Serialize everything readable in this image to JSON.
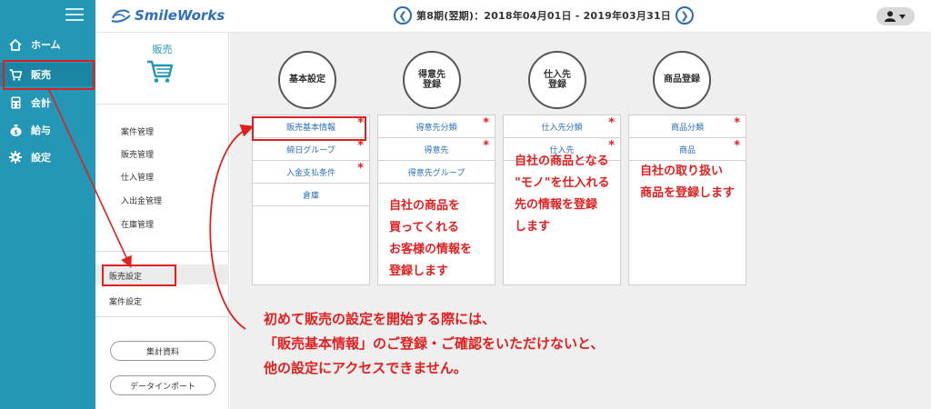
{
  "app": {
    "logo_text": "SmileWorks"
  },
  "header": {
    "period": "第8期(翌期)：2018年04月01日 - 2019年03月31日"
  },
  "nav": {
    "items": [
      {
        "label": "ホーム",
        "icon": "home-icon"
      },
      {
        "label": "販売",
        "icon": "cart-icon",
        "active": true
      },
      {
        "label": "会計",
        "icon": "calculator-icon"
      },
      {
        "label": "給与",
        "icon": "money-bag-icon"
      },
      {
        "label": "設定",
        "icon": "gear-icon"
      }
    ]
  },
  "subnav": {
    "title": "販売",
    "links": [
      "案件管理",
      "販売管理",
      "仕入管理",
      "入出金管理",
      "在庫管理"
    ],
    "settings": [
      "販売設定",
      "案件設定"
    ],
    "buttons": [
      "集計資料",
      "データインポート"
    ]
  },
  "columns": [
    {
      "title": "基本設定",
      "items": [
        {
          "label": "販売基本情報",
          "required": "*"
        },
        {
          "label": "締日グループ",
          "required": "*"
        },
        {
          "label": "入金支払条件",
          "required": "*"
        },
        {
          "label": "倉庫",
          "required": ""
        }
      ],
      "desc": ""
    },
    {
      "title": "得意先\n登録",
      "items": [
        {
          "label": "得意先分類",
          "required": "*"
        },
        {
          "label": "得意先",
          "required": "*"
        },
        {
          "label": "得意先グループ",
          "required": ""
        }
      ],
      "desc": "自社の商品を\n買ってくれる\nお客様の情報を\n登録します"
    },
    {
      "title": "仕入先\n登録",
      "items": [
        {
          "label": "仕入先分類",
          "required": "*"
        },
        {
          "label": "仕入先",
          "required": "*"
        }
      ],
      "desc": "自社の商品となる\n\"モノ\"を仕入れる\n先の情報を登録\nします"
    },
    {
      "title": "商品登録",
      "items": [
        {
          "label": "商品分類",
          "required": "*"
        },
        {
          "label": "商品",
          "required": "*"
        }
      ],
      "desc": "自社の取り扱い\n商品を登録します"
    }
  ],
  "annotation": {
    "lines": [
      "初めて販売の設定を開始する際には、",
      "「販売基本情報」のご登録・ご確認をいただけないと、",
      "他の設定にアクセスできません。"
    ]
  },
  "colors": {
    "nav_bg": "#2397b5",
    "accent_red": "#e02020",
    "link_blue": "#2a70b8"
  }
}
